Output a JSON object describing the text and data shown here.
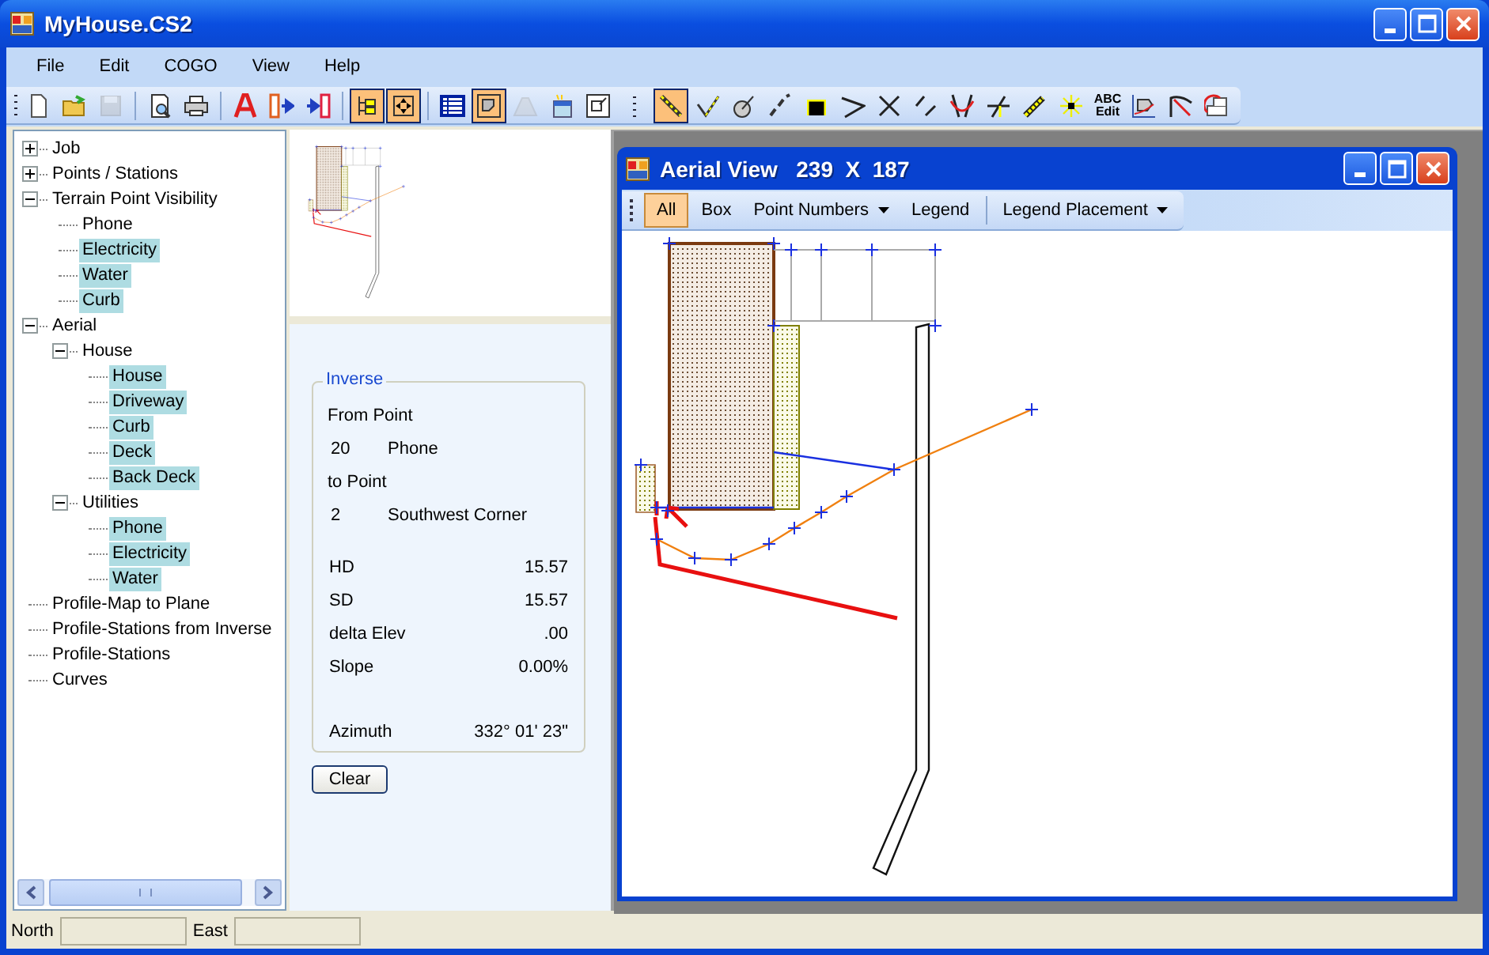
{
  "window": {
    "title": "MyHouse.CS2"
  },
  "menu": [
    "File",
    "Edit",
    "COGO",
    "View",
    "Help"
  ],
  "toolbar": [
    {
      "kind": "new",
      "selected": false,
      "disabled": false
    },
    {
      "kind": "open",
      "selected": false,
      "disabled": false
    },
    {
      "kind": "save",
      "selected": false,
      "disabled": true
    },
    {
      "kind": "separator"
    },
    {
      "kind": "preview",
      "selected": false,
      "disabled": false
    },
    {
      "kind": "print",
      "selected": false,
      "disabled": false
    },
    {
      "kind": "separator"
    },
    {
      "kind": "letter",
      "selected": false,
      "disabled": false
    },
    {
      "kind": "export",
      "selected": false,
      "disabled": false
    },
    {
      "kind": "import",
      "selected": false,
      "disabled": false
    },
    {
      "kind": "separator"
    },
    {
      "kind": "tree",
      "selected": true,
      "disabled": false
    },
    {
      "kind": "extents",
      "selected": true,
      "disabled": false
    },
    {
      "kind": "separator"
    },
    {
      "kind": "grid",
      "selected": false,
      "disabled": false
    },
    {
      "kind": "map",
      "selected": true,
      "disabled": false
    },
    {
      "kind": "road",
      "selected": false,
      "disabled": true
    },
    {
      "kind": "window",
      "selected": false,
      "disabled": false
    },
    {
      "kind": "frame",
      "selected": false,
      "disabled": false
    },
    {
      "kind": "grip",
      "selected": false,
      "disabled": false
    },
    {
      "kind": "line",
      "selected": true,
      "disabled": false
    },
    {
      "kind": "angle",
      "selected": false,
      "disabled": false
    },
    {
      "kind": "circle",
      "selected": false,
      "disabled": false
    },
    {
      "kind": "points",
      "selected": false,
      "disabled": false
    },
    {
      "kind": "raster",
      "selected": false,
      "disabled": false
    },
    {
      "kind": "bearing",
      "selected": false,
      "disabled": false
    },
    {
      "kind": "cross",
      "selected": false,
      "disabled": false
    },
    {
      "kind": "dashes",
      "selected": false,
      "disabled": false
    },
    {
      "kind": "intersect",
      "selected": false,
      "disabled": false
    },
    {
      "kind": "perpendicular",
      "selected": false,
      "disabled": false
    },
    {
      "kind": "pencil",
      "selected": false,
      "disabled": false
    },
    {
      "kind": "star",
      "selected": false,
      "disabled": false
    },
    {
      "kind": "text",
      "label": "ABC Edit",
      "selected": false,
      "disabled": false
    },
    {
      "kind": "polygon",
      "selected": false,
      "disabled": false
    },
    {
      "kind": "arc",
      "selected": false,
      "disabled": false
    },
    {
      "kind": "shapes",
      "selected": false,
      "disabled": false
    }
  ],
  "tree": [
    {
      "label": "Job",
      "expanded": false,
      "selected": false
    },
    {
      "label": "Points / Stations",
      "expanded": false,
      "selected": false
    },
    {
      "label": "Terrain Point Visibility",
      "expanded": true,
      "selected": false,
      "children": [
        {
          "label": "Phone",
          "selected": false
        },
        {
          "label": "Electricity",
          "selected": true
        },
        {
          "label": "Water",
          "selected": true
        },
        {
          "label": "Curb",
          "selected": true
        }
      ]
    },
    {
      "label": "Aerial",
      "expanded": true,
      "selected": false,
      "children": [
        {
          "label": "House",
          "expanded": true,
          "selected": false,
          "children": [
            {
              "label": "House",
              "selected": true
            },
            {
              "label": "Driveway",
              "selected": true
            },
            {
              "label": "Curb",
              "selected": true
            },
            {
              "label": "Deck",
              "selected": true
            },
            {
              "label": "Back Deck",
              "selected": true
            }
          ]
        },
        {
          "label": "Utilities",
          "expanded": true,
          "selected": false,
          "children": [
            {
              "label": "Phone",
              "selected": true
            },
            {
              "label": "Electricity",
              "selected": true
            },
            {
              "label": "Water",
              "selected": true
            }
          ]
        }
      ]
    },
    {
      "label": "Profile-Map to Plane",
      "selected": false
    },
    {
      "label": "Profile-Stations from Inverse",
      "selected": false
    },
    {
      "label": "Profile-Stations",
      "selected": false
    },
    {
      "label": "Curves",
      "selected": false
    }
  ],
  "inverse": {
    "title": "Inverse",
    "from_label": "From Point",
    "from_number": "20",
    "from_name": "Phone",
    "to_label": "to Point",
    "to_number": "2",
    "to_name": "Southwest Corner",
    "rows": [
      {
        "label": "HD",
        "value": "15.57"
      },
      {
        "label": "SD",
        "value": "15.57"
      },
      {
        "label": "delta Elev",
        "value": ".00"
      },
      {
        "label": "Slope",
        "value": "0.00%"
      }
    ],
    "azimuth_label": "Azimuth",
    "azimuth_value": "332° 01' 23\"",
    "button": "Clear"
  },
  "aerial_view": {
    "title": "Aerial View",
    "size": "239  X  187",
    "tools": [
      {
        "kind": "button",
        "label": "All",
        "selected": true
      },
      {
        "kind": "button",
        "label": "Box",
        "selected": false
      },
      {
        "kind": "dropdown",
        "label": "Point Numbers",
        "selected": false
      },
      {
        "kind": "button",
        "label": "Legend",
        "selected": false
      },
      {
        "kind": "separator"
      },
      {
        "kind": "dropdown",
        "label": "Legend Placement",
        "selected": false
      }
    ]
  },
  "status_bar": [
    {
      "label": "North"
    },
    {
      "label": "East"
    }
  ]
}
